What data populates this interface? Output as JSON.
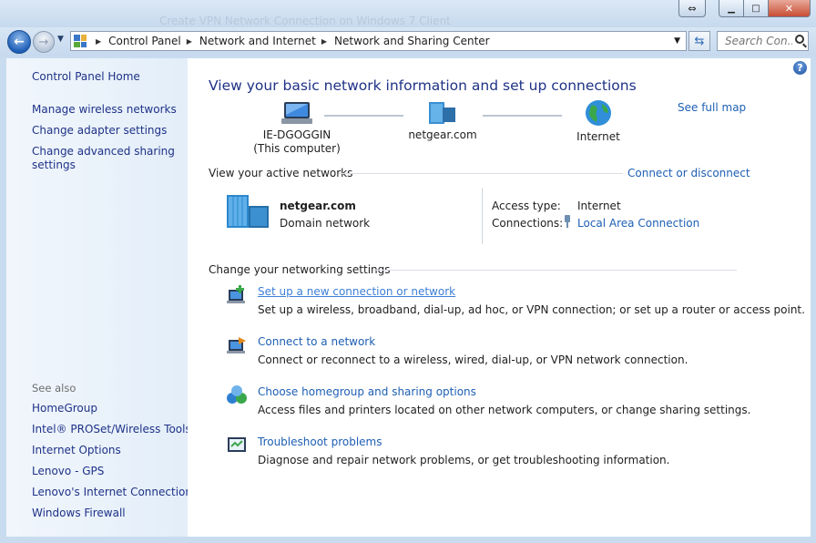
{
  "window": {
    "ghost_title": "Create VPN Network Connection on Windows 7 Client",
    "controls": {
      "resize": "⇔",
      "minimize": "▁",
      "maximize": "□",
      "close": "✕"
    }
  },
  "nav": {
    "back_icon": "back-arrow-icon",
    "forward_icon": "forward-arrow-icon",
    "breadcrumb": [
      "Control Panel",
      "Network and Internet",
      "Network and Sharing Center"
    ],
    "search_placeholder": "Search Con..."
  },
  "sidebar": {
    "top_links": [
      "Control Panel Home",
      "Manage wireless networks",
      "Change adapter settings",
      "Change advanced sharing settings"
    ],
    "see_also_heading": "See also",
    "see_also_links": [
      "HomeGroup",
      "Intel® PROSet/Wireless Tools",
      "Internet Options",
      "Lenovo - GPS",
      "Lenovo's Internet Connection",
      "Windows Firewall"
    ]
  },
  "main": {
    "title": "View your basic network information and set up connections",
    "see_full_map": "See full map",
    "map": {
      "computer_name": "IE-DGOGGIN",
      "computer_sub": "(This computer)",
      "network": "netgear.com",
      "internet": "Internet"
    },
    "active": {
      "heading": "View your active networks",
      "connect_disconnect": "Connect or disconnect",
      "network_name": "netgear.com",
      "network_category": "Domain network",
      "access_type_label": "Access type:",
      "access_type_value": "Internet",
      "connections_label": "Connections:",
      "connections_value": "Local Area Connection"
    },
    "settings": {
      "heading": "Change your networking settings",
      "tasks": [
        {
          "link": "Set up a new connection or network",
          "desc": "Set up a wireless, broadband, dial-up, ad hoc, or VPN connection; or set up a router or access point."
        },
        {
          "link": "Connect to a network",
          "desc": "Connect or reconnect to a wireless, wired, dial-up, or VPN network connection."
        },
        {
          "link": "Choose homegroup and sharing options",
          "desc": "Access files and printers located on other network computers, or change sharing settings."
        },
        {
          "link": "Troubleshoot problems",
          "desc": "Diagnose and repair network problems, or get troubleshooting information."
        }
      ]
    }
  },
  "colors": {
    "link": "#1e5fb4",
    "title": "#1e3287",
    "frame": "#c9dcef"
  }
}
